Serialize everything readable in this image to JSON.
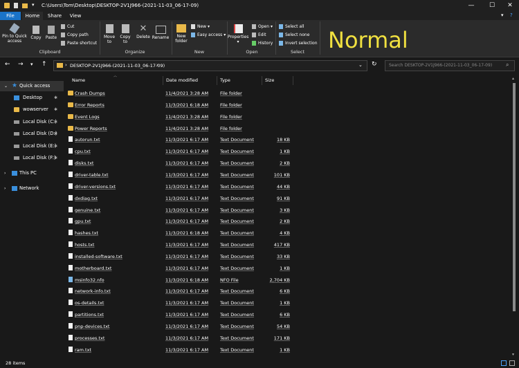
{
  "window": {
    "path": "C:\\Users\\Tom\\Desktop\\DESKTOP-2V1J966-(2021-11-03_06-17-09)",
    "minimize": "—",
    "maximize": "☐",
    "close": "✕"
  },
  "tabs": [
    "File",
    "Home",
    "Share",
    "View"
  ],
  "ribbon": {
    "clipboard": {
      "pin": "Pin to Quick access",
      "copy": "Copy",
      "paste": "Paste",
      "cut": "Cut",
      "copy_path": "Copy path",
      "paste_shortcut": "Paste shortcut",
      "label": "Clipboard"
    },
    "organize": {
      "move_to": "Move to",
      "copy_to": "Copy to",
      "delete": "Delete",
      "rename": "Rename",
      "label": "Organize"
    },
    "new": {
      "new_folder": "New folder",
      "new_item": "New",
      "easy_access": "Easy access",
      "label": "New"
    },
    "open": {
      "properties": "Properties",
      "open": "Open",
      "edit": "Edit",
      "history": "History",
      "label": "Open"
    },
    "select": {
      "select_all": "Select all",
      "select_none": "Select none",
      "invert": "Invert selection",
      "label": "Select"
    }
  },
  "overlay_text": "Normal",
  "address": {
    "crumb": "DESKTOP-2V1J966-(2021-11-03_06-17-09)",
    "search_placeholder": "Search DESKTOP-2V1J966-(2021-11-03_06-17-09)"
  },
  "sidebar": {
    "items": [
      {
        "label": "Quick access",
        "icon": "star-icon"
      },
      {
        "label": "Desktop",
        "icon": "desktop-icon"
      },
      {
        "label": "wowserver",
        "icon": "folder-icon"
      },
      {
        "label": "Local Disk (C:)",
        "icon": "drive-icon"
      },
      {
        "label": "Local Disk (D:)",
        "icon": "drive-icon"
      },
      {
        "label": "Local Disk (E:)",
        "icon": "drive-icon"
      },
      {
        "label": "Local Disk (F:)",
        "icon": "drive-icon"
      },
      {
        "label": "This PC",
        "icon": "pc-icon"
      },
      {
        "label": "Network",
        "icon": "network-icon"
      }
    ]
  },
  "columns": {
    "name": "Name",
    "date": "Date modified",
    "type": "Type",
    "size": "Size"
  },
  "files": [
    {
      "name": "Crash Dumps",
      "date": "11/4/2021 3:28 AM",
      "type": "File folder",
      "size": "",
      "kind": "folder"
    },
    {
      "name": "Error Reports",
      "date": "11/3/2021 6:18 AM",
      "type": "File folder",
      "size": "",
      "kind": "folder"
    },
    {
      "name": "Event Logs",
      "date": "11/4/2021 3:28 AM",
      "type": "File folder",
      "size": "",
      "kind": "folder"
    },
    {
      "name": "Power Reports",
      "date": "11/4/2021 3:28 AM",
      "type": "File folder",
      "size": "",
      "kind": "folder"
    },
    {
      "name": "autorun.txt",
      "date": "11/3/2021 6:17 AM",
      "type": "Text Document",
      "size": "18 KB",
      "kind": "doc"
    },
    {
      "name": "cpu.txt",
      "date": "11/3/2021 6:17 AM",
      "type": "Text Document",
      "size": "1 KB",
      "kind": "doc"
    },
    {
      "name": "disks.txt",
      "date": "11/3/2021 6:17 AM",
      "type": "Text Document",
      "size": "2 KB",
      "kind": "doc"
    },
    {
      "name": "driver-table.txt",
      "date": "11/3/2021 6:17 AM",
      "type": "Text Document",
      "size": "101 KB",
      "kind": "doc"
    },
    {
      "name": "driver-versions.txt",
      "date": "11/3/2021 6:17 AM",
      "type": "Text Document",
      "size": "44 KB",
      "kind": "doc"
    },
    {
      "name": "dxdiag.txt",
      "date": "11/3/2021 6:17 AM",
      "type": "Text Document",
      "size": "91 KB",
      "kind": "doc"
    },
    {
      "name": "genuine.txt",
      "date": "11/3/2021 6:17 AM",
      "type": "Text Document",
      "size": "3 KB",
      "kind": "doc"
    },
    {
      "name": "gpu.txt",
      "date": "11/3/2021 6:17 AM",
      "type": "Text Document",
      "size": "2 KB",
      "kind": "doc"
    },
    {
      "name": "hashes.txt",
      "date": "11/3/2021 6:18 AM",
      "type": "Text Document",
      "size": "4 KB",
      "kind": "doc"
    },
    {
      "name": "hosts.txt",
      "date": "11/3/2021 6:17 AM",
      "type": "Text Document",
      "size": "417 KB",
      "kind": "doc"
    },
    {
      "name": "installed-software.txt",
      "date": "11/3/2021 6:17 AM",
      "type": "Text Document",
      "size": "33 KB",
      "kind": "doc"
    },
    {
      "name": "motherboard.txt",
      "date": "11/3/2021 6:17 AM",
      "type": "Text Document",
      "size": "1 KB",
      "kind": "doc"
    },
    {
      "name": "msinfo32.nfo",
      "date": "11/3/2021 6:18 AM",
      "type": "NFO File",
      "size": "2,704 KB",
      "kind": "nfo"
    },
    {
      "name": "network-info.txt",
      "date": "11/3/2021 6:17 AM",
      "type": "Text Document",
      "size": "6 KB",
      "kind": "doc"
    },
    {
      "name": "os-details.txt",
      "date": "11/3/2021 6:17 AM",
      "type": "Text Document",
      "size": "1 KB",
      "kind": "doc"
    },
    {
      "name": "partitions.txt",
      "date": "11/3/2021 6:17 AM",
      "type": "Text Document",
      "size": "6 KB",
      "kind": "doc"
    },
    {
      "name": "pnp-devices.txt",
      "date": "11/3/2021 6:17 AM",
      "type": "Text Document",
      "size": "54 KB",
      "kind": "doc"
    },
    {
      "name": "processes.txt",
      "date": "11/3/2021 6:17 AM",
      "type": "Text Document",
      "size": "171 KB",
      "kind": "doc"
    },
    {
      "name": "ram.txt",
      "date": "11/3/2021 6:17 AM",
      "type": "Text Document",
      "size": "1 KB",
      "kind": "doc"
    }
  ],
  "status": {
    "items": "28 items"
  },
  "colors": {
    "accent": "#1a73c8",
    "overlay_text": "#f0e040",
    "folder": "#e9b949"
  }
}
